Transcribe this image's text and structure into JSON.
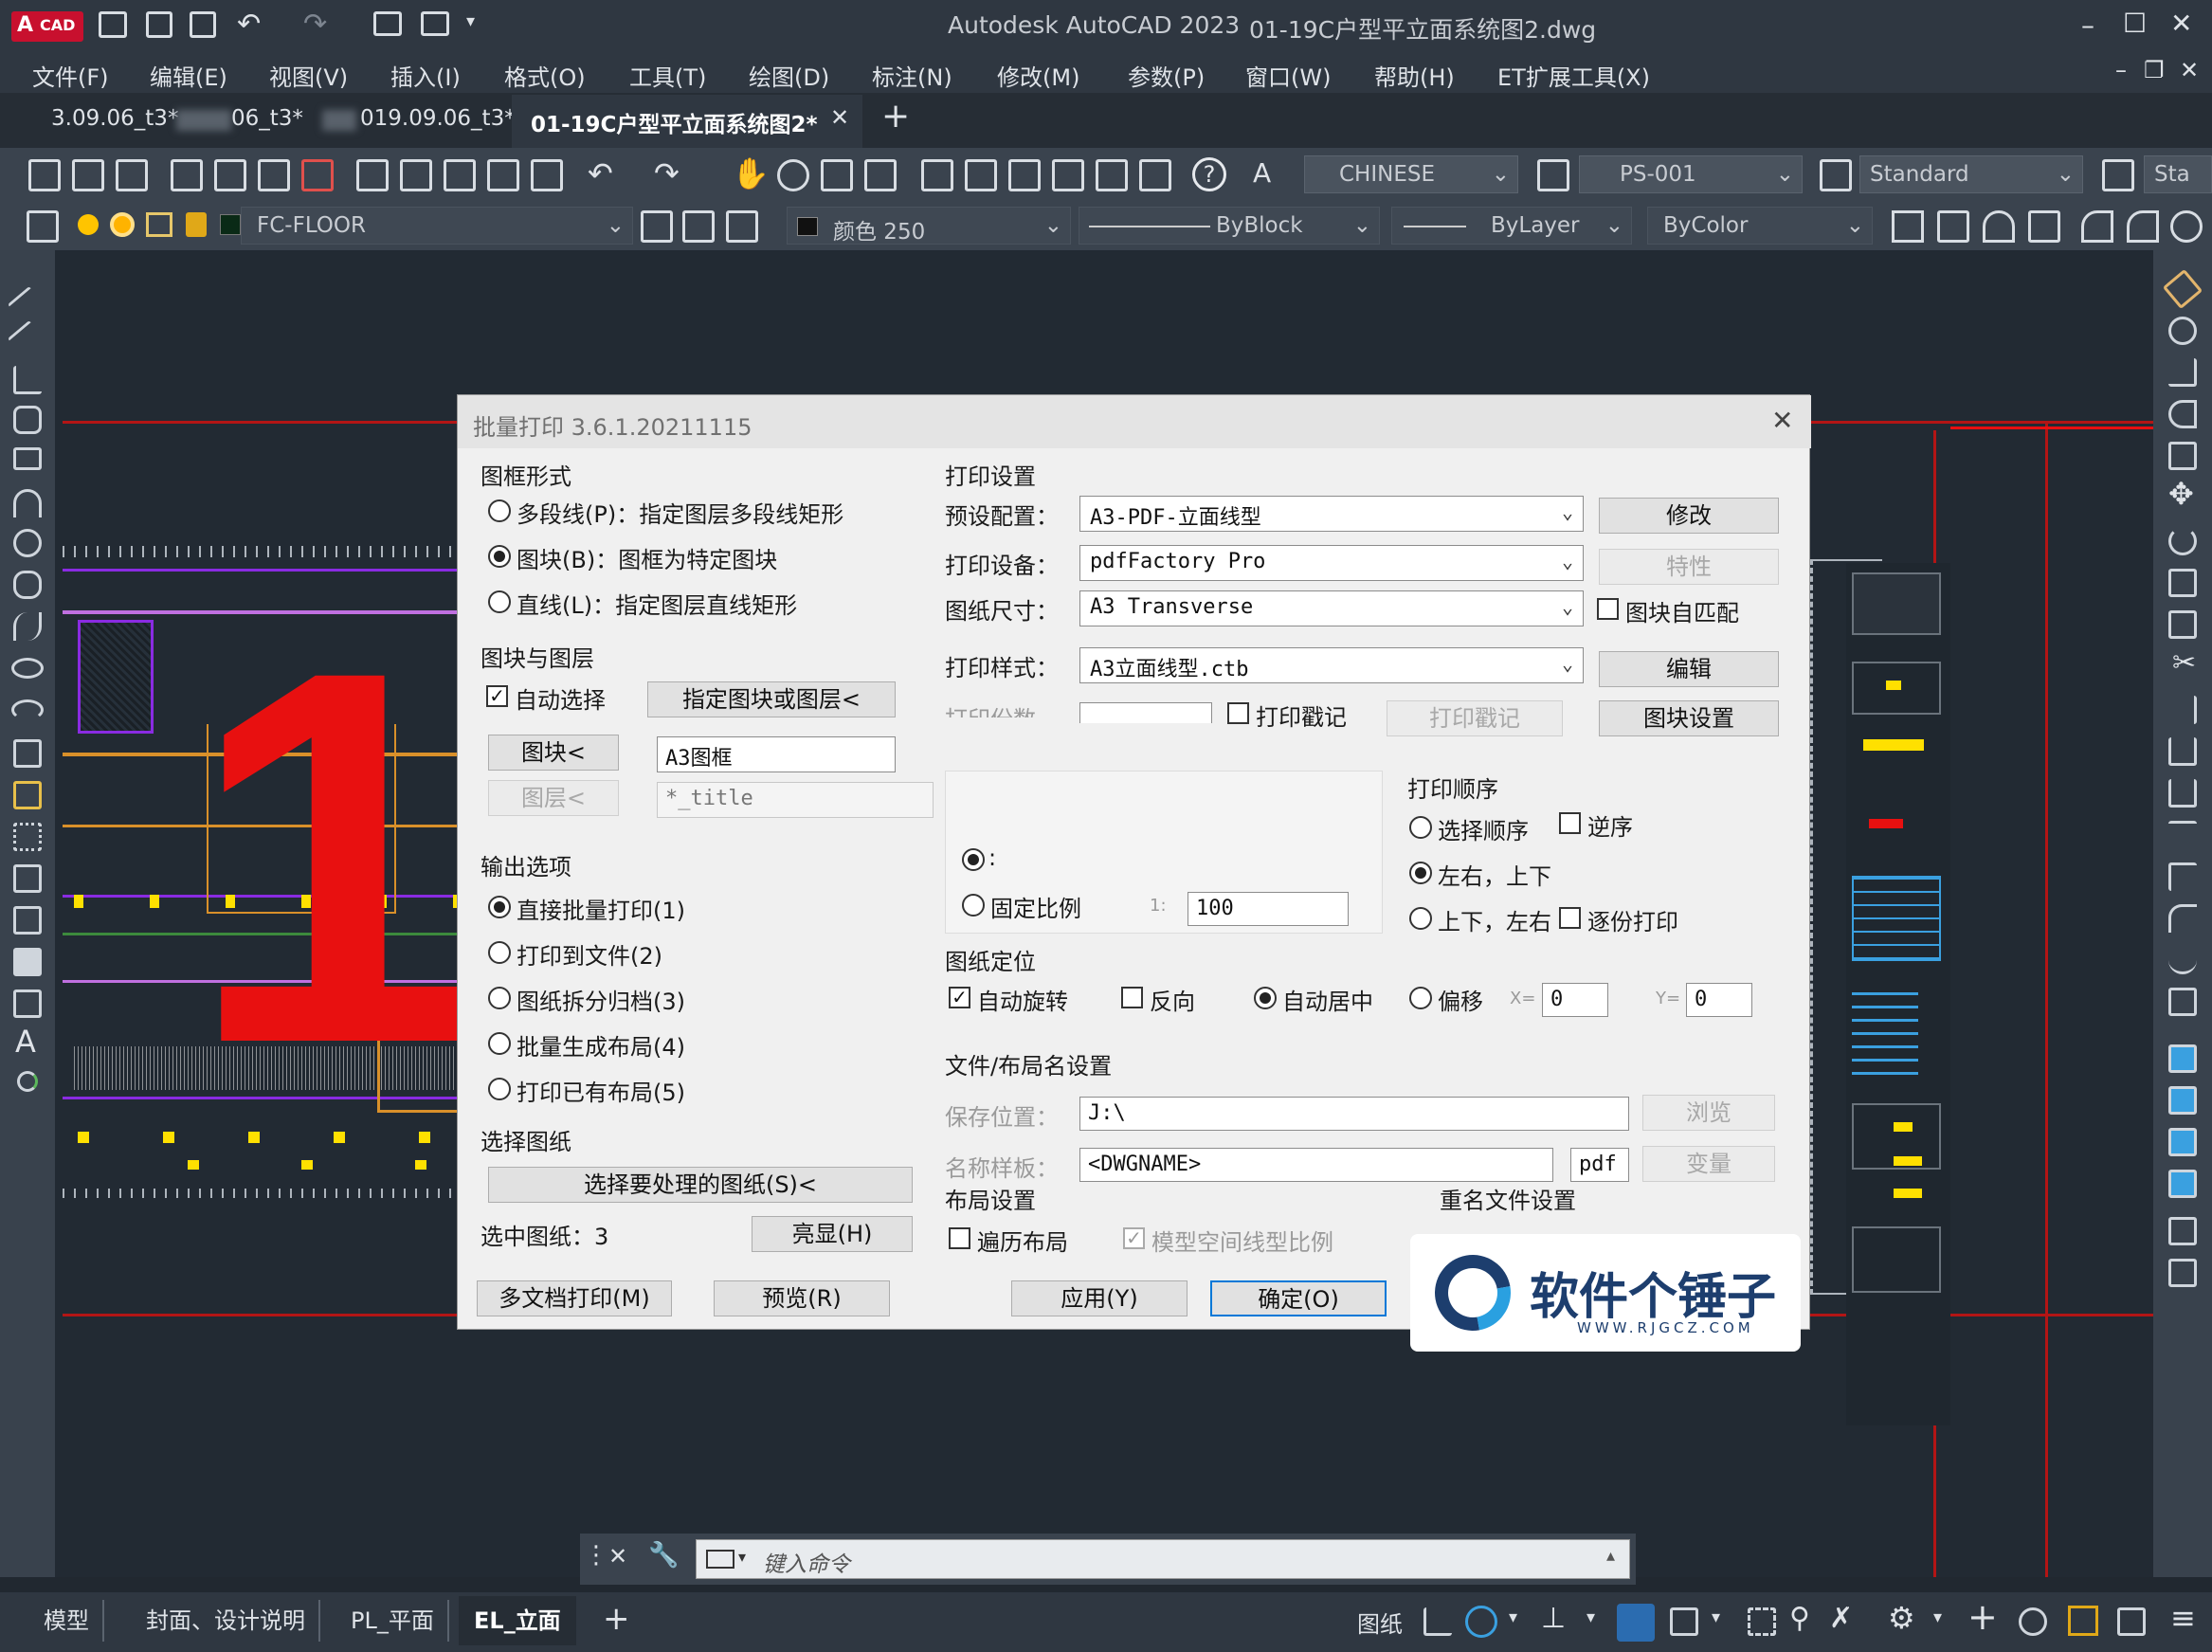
{
  "app": {
    "logo": "A",
    "logo_tag": "CAD",
    "title": "Autodesk AutoCAD 2023",
    "file": "01-19C户型平立面系统图2.dwg",
    "window_min": "–",
    "window_max": "☐",
    "window_close": "✕"
  },
  "menu": [
    "文件(F)",
    "编辑(E)",
    "视图(V)",
    "插入(I)",
    "格式(O)",
    "工具(T)",
    "绘图(D)",
    "标注(N)",
    "修改(M)",
    "参数(P)",
    "窗口(W)",
    "帮助(H)",
    "ET扩展工具(X)"
  ],
  "doc_tabs": [
    {
      "label": "3.09.06_t3*"
    },
    {
      "label": "06_t3*"
    },
    {
      "label": "019.09.06_t3*"
    },
    {
      "label": "01-19C户型平立面系统图2*"
    }
  ],
  "new_tab": "+",
  "toolbar": {
    "text_style": "CHINESE",
    "dim_style": "PS-001",
    "table_style": "Standard",
    "overflow_style": "Sta",
    "layer": "FC-FLOOR",
    "color": "颜色 250",
    "linetype": "ByBlock",
    "lineweight": "ByLayer",
    "plotstyle": "ByColor"
  },
  "big_label": "1",
  "dialog": {
    "title": "批量打印 3.6.1.20211115",
    "close": "✕",
    "frame_group": "图框形式",
    "frame_opts": [
      {
        "label": "多段线(P)：指定图层多段线矩形",
        "checked": false
      },
      {
        "label": "图块(B)：图框为特定图块",
        "checked": true
      },
      {
        "label": "直线(L)：指定图层直线矩形",
        "checked": false
      }
    ],
    "block_group": "图块与图层",
    "auto_select": "自动选择",
    "pick_btn": "指定图块或图层<",
    "block_btn": "图块<",
    "block_value": "A3图框",
    "layer_btn": "图层<",
    "layer_value": "*_title",
    "output_group": "输出选项",
    "output_opts": [
      {
        "label": "直接批量打印(1)",
        "checked": true
      },
      {
        "label": "打印到文件(2)",
        "checked": false
      },
      {
        "label": "图纸拆分归档(3)",
        "checked": false
      },
      {
        "label": "批量生成布局(4)",
        "checked": false
      },
      {
        "label": "打印已有布局(5)",
        "checked": false
      }
    ],
    "select_group": "选择图纸",
    "select_btn": "选择要处理的图纸(S)<",
    "selected_label": "选中图纸：3",
    "highlight_btn": "亮显(H)",
    "multi_btn": "多文档打印(M)",
    "preview_btn": "预览(R)",
    "print_group": "打印设置",
    "preset_label": "预设配置：",
    "preset_value": "A3-PDF-立面线型",
    "modify_btn": "修改",
    "device_label": "打印设备：",
    "device_value": "pdfFactory Pro",
    "props_btn": "特性",
    "paper_label": "图纸尺寸：",
    "paper_value": "A3 Transverse",
    "block_match": "图块自匹配",
    "style_label": "打印样式：",
    "style_value": "A3立面线型.ctb",
    "edit_btn": "编辑",
    "copies_label": "打印份数",
    "stamp_chk": "打印戳记",
    "stamp_btn": "打印戳记",
    "block_settings_btn": "图块设置",
    "order_group": "打印顺序",
    "order_opts": [
      {
        "label": "选择顺序",
        "checked": false
      },
      {
        "label": "左右，上下",
        "checked": true
      },
      {
        "label": "上下，左右",
        "checked": false
      }
    ],
    "reverse_chk": "逆序",
    "collate_chk": "逐份打印",
    "scale_fit": ":",
    "scale_fixed": "固定比例",
    "scale_prefix": "1:",
    "scale_value": "100",
    "position_group": "图纸定位",
    "auto_rotate": "自动旋转",
    "reverse_dir": "反向",
    "auto_center": "自动居中",
    "offset": "偏移",
    "x_label": "X=",
    "x_value": "0",
    "y_label": "Y=",
    "y_value": "0",
    "file_group": "文件/布局名设置",
    "save_label": "保存位置：",
    "save_value": "J:\\",
    "browse_btn": "浏览",
    "name_label": "名称样板：",
    "name_value": "<DWGNAME>",
    "ext_value": "pdf",
    "var_btn": "变量",
    "layout_group": "布局设置",
    "iterate_layout": "遍历布局",
    "model_scale": "模型空间线型比例",
    "rename_group": "重名文件设置",
    "apply_btn": "应用(Y)",
    "ok_btn": "确定(O)"
  },
  "watermark": {
    "text": "软件个锤子",
    "url": "WWW.RJGCZ.COM"
  },
  "command": {
    "placeholder": "键入命令"
  },
  "layout_tabs": [
    "模型",
    "封面、设计说明",
    "PL_平面",
    "EL_立面"
  ],
  "status": {
    "paper": "图纸"
  },
  "colors": {
    "accent_red": "#e81010",
    "purple": "#8a2be2",
    "yellow": "#ffe000",
    "orange": "#d9902a"
  }
}
